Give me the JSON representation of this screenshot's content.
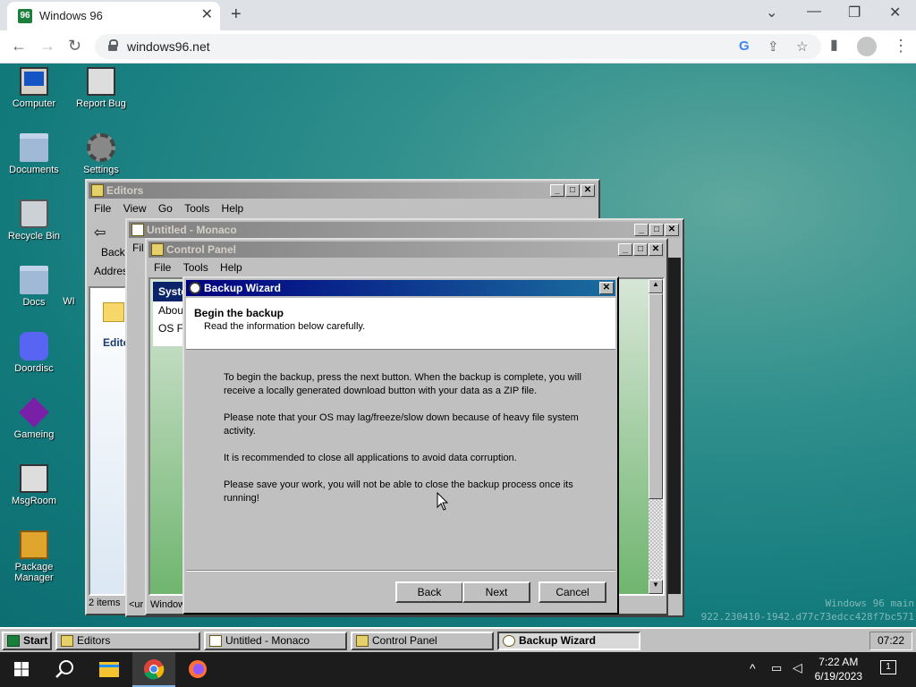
{
  "browser": {
    "tab_title": "Windows 96",
    "tab_favicon": "96",
    "url": "windows96.net",
    "window_controls": [
      "⌄",
      "—",
      "❐",
      "✕"
    ]
  },
  "desktop": {
    "icons": [
      {
        "label": "Computer",
        "icon": "monitor-icon"
      },
      {
        "label": "Report Bug",
        "icon": "report-bug-icon"
      },
      {
        "label": "Documents",
        "icon": "folder-icon"
      },
      {
        "label": "Settings",
        "icon": "settings-icon"
      },
      {
        "label": "Recycle Bin",
        "icon": "recycle-bin-icon"
      },
      {
        "label": "Docs",
        "icon": "folder-icon"
      },
      {
        "label": "Doordisc",
        "icon": "discord-icon"
      },
      {
        "label": "Gameing",
        "icon": "cube-icon"
      },
      {
        "label": "MsgRoom",
        "icon": "msgroom-icon"
      },
      {
        "label": "Package Manager",
        "icon": "package-icon"
      }
    ],
    "partial_icon_text": "WI",
    "watermark_line1": "Windows 96 main",
    "watermark_line2": "922.230410-1942.d77c73edcc428f7bc571"
  },
  "editors": {
    "title": "Editors",
    "menu": [
      "File",
      "View",
      "Go",
      "Tools",
      "Help"
    ],
    "back_label": "Back",
    "address_label": "Addres",
    "folder_label": "Edito",
    "status": "2 items"
  },
  "monaco": {
    "title": "Untitled - Monaco",
    "menu_partial": "Fil",
    "status_partial": "<ur"
  },
  "control_panel": {
    "title": "Control Panel",
    "menu": [
      "File",
      "Tools",
      "Help"
    ],
    "panel_header": "Syste",
    "items": [
      "About",
      "OS Fla"
    ],
    "status_partial": "Window"
  },
  "wizard": {
    "title": "Backup Wizard",
    "heading": "Begin the backup",
    "subheading": "Read the information below carefully.",
    "paragraphs": [
      "To begin the backup, press the next button. When the backup is complete, you will receive a locally generated download button with your data as a ZIP file.",
      "Please note that your OS may lag/freeze/slow down because of heavy file system activity.",
      "It is recommended to close all applications to avoid data corruption.",
      "Please save your work, you will not be able to close the backup process once its running!"
    ],
    "buttons": {
      "back": "Back",
      "next": "Next",
      "cancel": "Cancel"
    }
  },
  "w96_taskbar": {
    "start": "Start",
    "tasks": [
      "Editors",
      "Untitled - Monaco",
      "Control Panel",
      "Backup Wizard"
    ],
    "clock": "07:22"
  },
  "windows_taskbar": {
    "time": "7:22 AM",
    "date": "6/19/2023",
    "notification_count": "1"
  },
  "colors": {
    "desktop_teal": "#137a7c",
    "active_title": "#000080",
    "win_face": "#c0c0c0"
  }
}
